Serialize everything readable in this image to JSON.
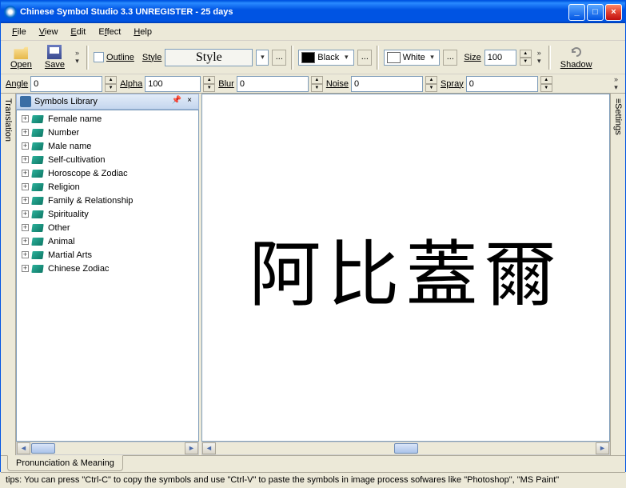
{
  "window": {
    "title": "Chinese Symbol Studio 3.3 UNREGISTER - 25 days"
  },
  "menu": {
    "file": "File",
    "view": "View",
    "edit": "Edit",
    "effect": "Effect",
    "help": "Help"
  },
  "toolbar": {
    "open": "Open",
    "save": "Save",
    "outline": "Outline",
    "style": "Style",
    "color1_name": "Black",
    "color2_name": "White",
    "size_label": "Size",
    "size_value": "100",
    "shadow": "Shadow"
  },
  "params": {
    "angle_label": "Angle",
    "angle_value": "0",
    "alpha_label": "Alpha",
    "alpha_value": "100",
    "blur_label": "Blur",
    "blur_value": "0",
    "noise_label": "Noise",
    "noise_value": "0",
    "spray_label": "Spray",
    "spray_value": "0"
  },
  "sidebar": {
    "vtab_left": "Translation",
    "vtab_right": "Settings",
    "panel_title": "Symbols Library",
    "items": [
      {
        "label": "Female name"
      },
      {
        "label": "Number"
      },
      {
        "label": "Male name"
      },
      {
        "label": "Self-cultivation"
      },
      {
        "label": "Horoscope & Zodiac"
      },
      {
        "label": "Religion"
      },
      {
        "label": "Family & Relationship"
      },
      {
        "label": "Spirituality"
      },
      {
        "label": "Other"
      },
      {
        "label": "Animal"
      },
      {
        "label": "Martial Arts"
      },
      {
        "label": "Chinese Zodiac"
      }
    ]
  },
  "canvas": {
    "text": "阿比蓋爾"
  },
  "bottom_tab": "Pronunciation & Meaning",
  "status": "tips: You can press \"Ctrl-C\" to copy the symbols and use \"Ctrl-V\" to paste the symbols in image process sofwares like \"Photoshop\", \"MS Paint\""
}
